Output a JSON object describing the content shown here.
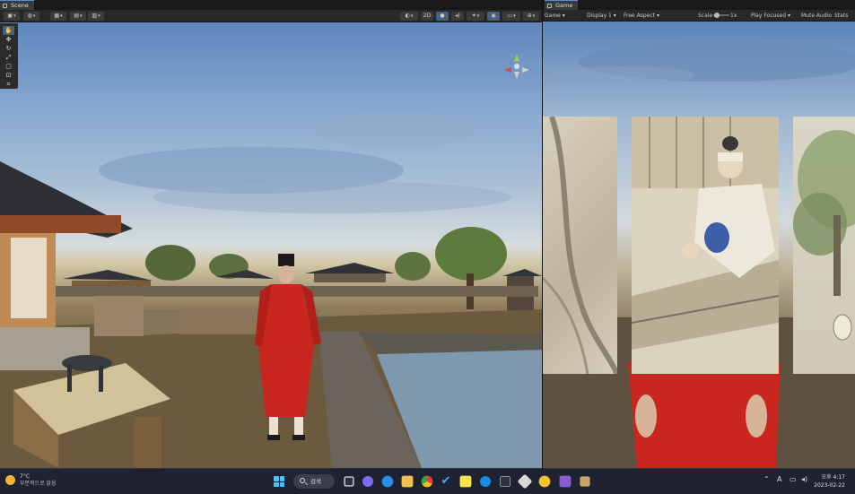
{
  "scene": {
    "tab_label": "Scene",
    "toolbar": {
      "view_2d_label": "2D"
    },
    "tools": [
      "hand",
      "move",
      "rotate",
      "scale",
      "rect",
      "transform",
      "custom"
    ]
  },
  "game": {
    "tab_label": "Game",
    "toolbar": {
      "mode": "Game",
      "display": "Display 1",
      "aspect": "Free Aspect",
      "scale_label": "Scale",
      "scale_value": "1x",
      "play_mode": "Play Focused",
      "mute_audio": "Mute Audio",
      "stats": "Stats"
    }
  },
  "taskbar": {
    "weather_temp": "7°C",
    "weather_desc": "부분적으로 맑음",
    "search_label": "검색",
    "ime_label": "A",
    "clock_time": "오후 4:17",
    "clock_date": "2023-02-22",
    "pinned_apps": [
      "task-view",
      "chat",
      "edge",
      "file-explorer",
      "chrome",
      "todo",
      "kakaotalk",
      "app-blue",
      "app-dark",
      "unity",
      "app-yellow",
      "visual-studio",
      "app-box"
    ]
  },
  "colors": {
    "editor_bg": "#202020",
    "active_tool": "#46607f",
    "taskbar_bg": "#1f2230",
    "robe_red": "#c8261e"
  }
}
